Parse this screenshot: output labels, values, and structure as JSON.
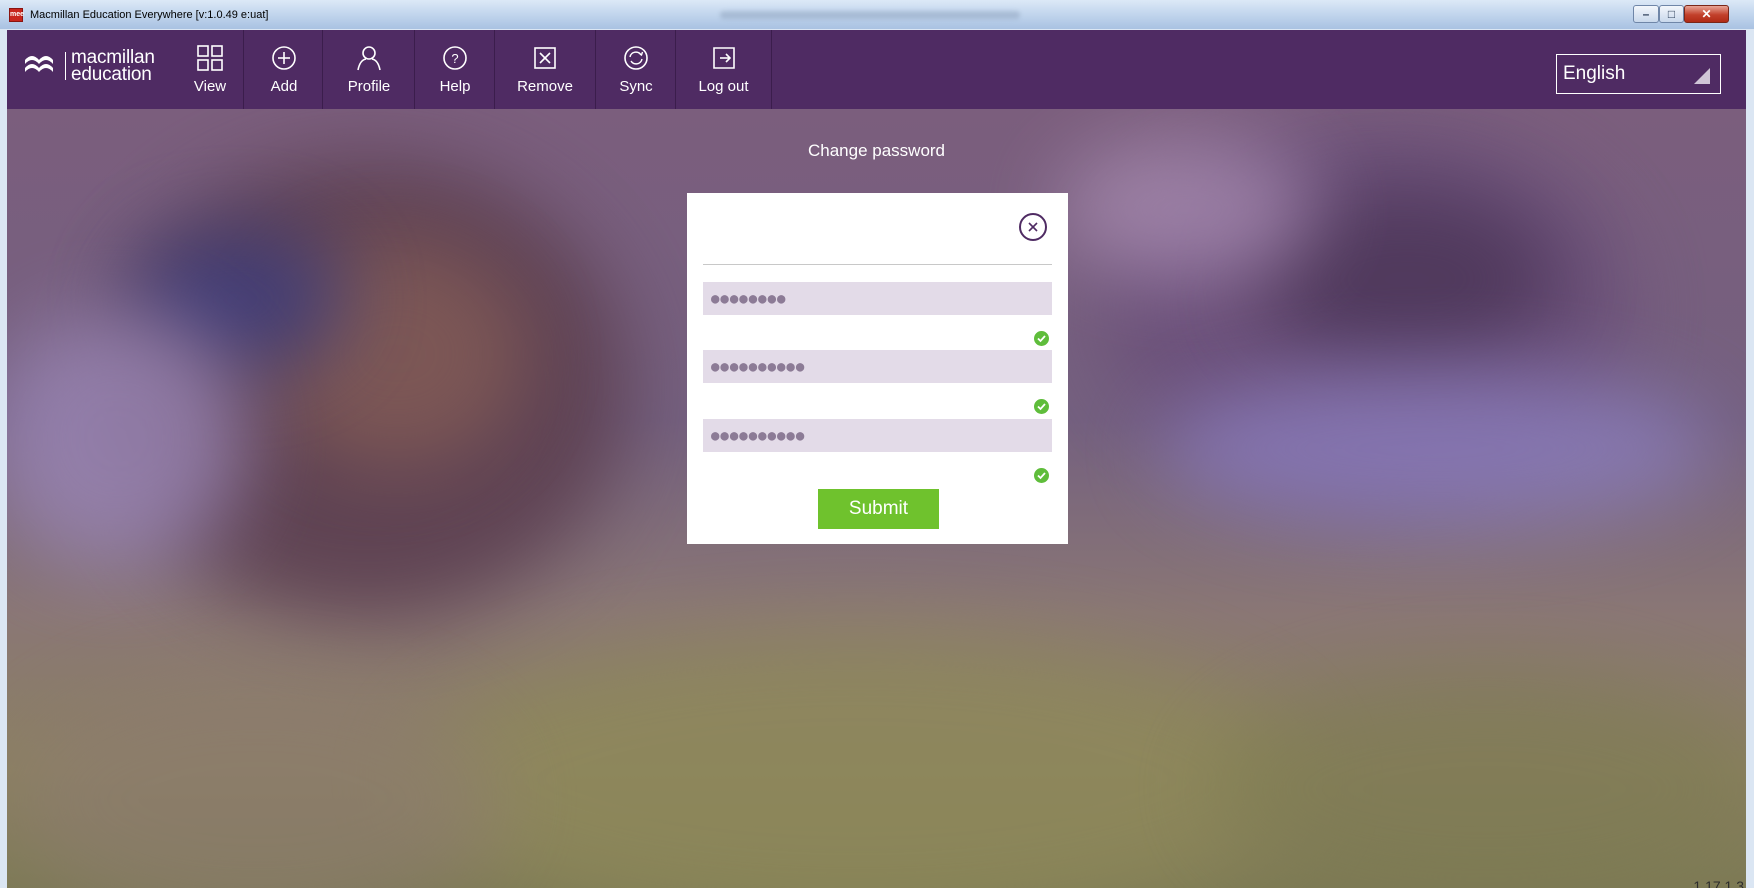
{
  "window": {
    "title": "Macmillan Education Everywhere [v:1.0.49 e:uat]",
    "app_icon_text": "mee",
    "controls": {
      "minimize": "–",
      "maximize": "□",
      "close": "✕"
    }
  },
  "brand": {
    "line1": "macmillan",
    "line2": "education",
    "logo_icon": "macmillan-waves-logo"
  },
  "toolbar": {
    "buttons": [
      {
        "label": "View",
        "icon": "grid-icon"
      },
      {
        "label": "Add",
        "icon": "plus-circle-icon"
      },
      {
        "label": "Profile",
        "icon": "user-icon"
      },
      {
        "label": "Help",
        "icon": "question-circle-icon"
      },
      {
        "label": "Remove",
        "icon": "remove-box-icon"
      },
      {
        "label": "Sync",
        "icon": "sync-icon"
      },
      {
        "label": "Log out",
        "icon": "logout-icon"
      }
    ],
    "language": {
      "selected": "English"
    }
  },
  "page": {
    "title": "Change password",
    "version": "1.17.1.3"
  },
  "dialog": {
    "fields": [
      {
        "value": "●●●●●●●●",
        "valid": true
      },
      {
        "value": "●●●●●●●●●●",
        "valid": true
      },
      {
        "value": "●●●●●●●●●●",
        "valid": true
      }
    ],
    "submit_label": "Submit"
  },
  "colors": {
    "toolbar_bg": "#4f2b63",
    "field_bg": "#e3dbe8",
    "submit_bg": "#6fc22d",
    "check_green": "#5fbd3b"
  }
}
